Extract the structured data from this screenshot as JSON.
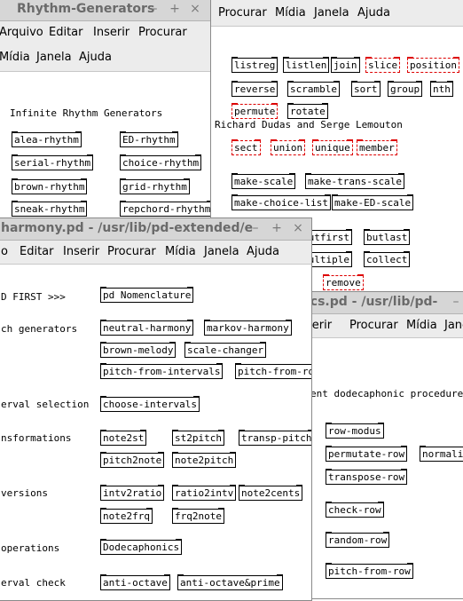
{
  "rhythm_window": {
    "title": "Rhythm-Generators",
    "menus": [
      "Arquivo",
      "Editar",
      "Inserir",
      "Procurar",
      "Mídia",
      "Janela",
      "Ajuda"
    ],
    "comment": "Infinite Rhythm Generators",
    "objects": [
      "alea-rhythm",
      "ED-rhythm",
      "serial-rhythm",
      "choice-rhythm",
      "brown-rhythm",
      "grid-rhythm",
      "sneak-rhythm",
      "repchord-rhythm"
    ]
  },
  "list_window": {
    "menus": [
      "Procurar",
      "Mídia",
      "Janela",
      "Ajuda"
    ],
    "objects": [
      "listreg",
      "listlen",
      "join",
      "slice",
      "position",
      "reverse",
      "scramble",
      "sort",
      "group",
      "nth",
      "permute",
      "rotate",
      "sect",
      "union",
      "unique",
      "member",
      "make-scale",
      "make-trans-scale",
      "make-choice-list",
      "make-ED-scale",
      "outfirst",
      "butlast",
      "multiple",
      "collect",
      "remove"
    ],
    "comment": "Richard Dudas and Serge Lemouton"
  },
  "harmony_window": {
    "title": "harmony.pd  - /usr/lib/pd-extended/e",
    "menus": [
      "o",
      "Editar",
      "Inserir",
      "Procurar",
      "Mídia",
      "Janela",
      "Ajuda"
    ],
    "comments": [
      "D FIRST >>>",
      "ch generators",
      "erval selection",
      "nsformations",
      "versions",
      "operations",
      "erval check"
    ],
    "objects": [
      "pd Nomenclature",
      "neutral-harmony",
      "markov-harmony",
      "brown-melody",
      "scale-changer",
      "pitch-from-intervals",
      "pitch-from-row",
      "choose-intervals",
      "note2st",
      "st2pitch",
      "transp-pitch",
      "pitch2note",
      "note2pitch",
      "intv2ratio",
      "ratio2intv",
      "note2cents",
      "note2frq",
      "frq2note",
      "Dodecaphonics",
      "anti-octave",
      "anti-octave&prime"
    ]
  },
  "dodeca_window": {
    "title": "ics.pd  - /usr/lib/pd-",
    "menus": [
      "serir",
      "Procurar",
      "Mídia",
      "Jane"
    ],
    "comment": "ent dodecaphonic procedures",
    "objects": [
      "row-modus",
      "permutate-row",
      "normaliz",
      "transpose-row",
      "check-row",
      "random-row",
      "pitch-from-row"
    ]
  },
  "window_controls": [
    "–",
    "+",
    "×"
  ]
}
